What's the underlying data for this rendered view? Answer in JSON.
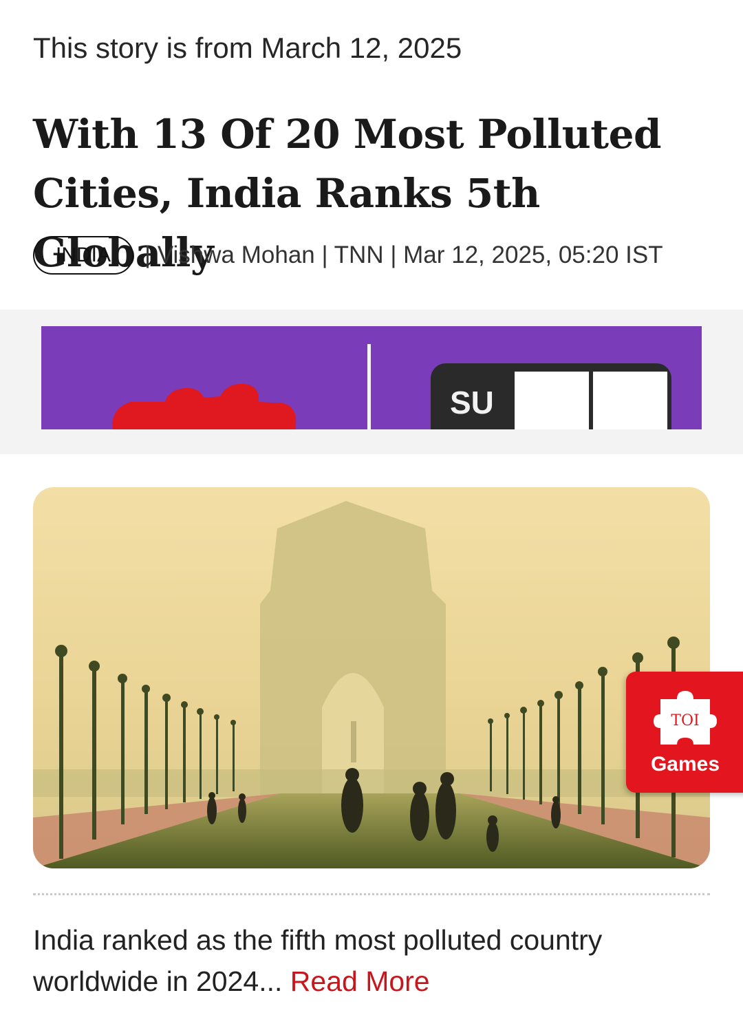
{
  "story": {
    "date_note": "This story is from March 12, 2025",
    "headline": "With 13 Of 20 Most Polluted Cities, India Ranks 5th Globally",
    "section": "INDIA",
    "byline": "| Vishwa Mohan | TNN | Mar 12, 2025, 05:20 IST"
  },
  "ad": {
    "tile_letters": "SU"
  },
  "hero_image": {
    "subject": "India Gate in smog"
  },
  "games_badge": {
    "logo_text": "TOI",
    "label": "Games"
  },
  "summary": {
    "text": "India ranked as the fifth most polluted country worldwide in 2024...",
    "read_more": "Read More"
  },
  "colors": {
    "accent_red": "#e3161f",
    "link_red": "#c8161d",
    "ad_purple": "#7a3cb8"
  }
}
